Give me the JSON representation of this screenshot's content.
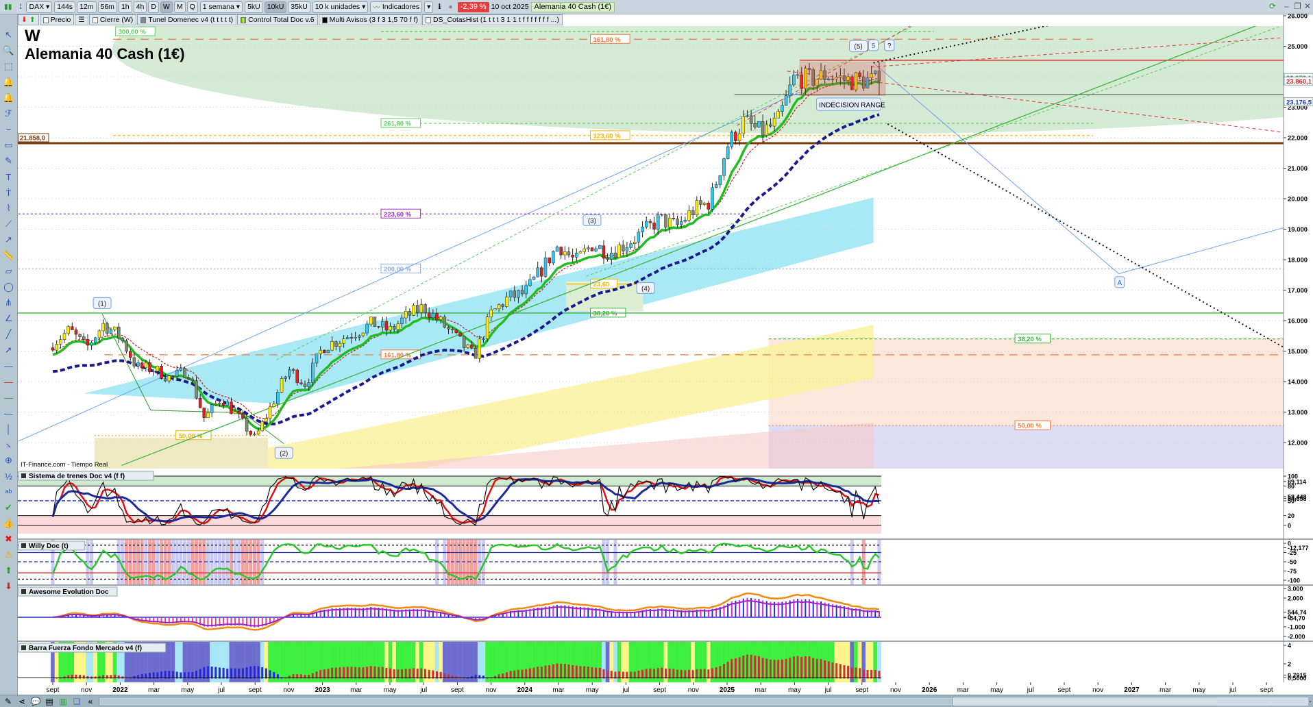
{
  "toolbar": {
    "symbol": "DAX",
    "timeframes": [
      "144s",
      "12m",
      "56m",
      "1h",
      "4h",
      "D",
      "W",
      "M",
      "Q"
    ],
    "active_timeframe": "W",
    "period": "1 semana",
    "units": [
      "5kU",
      "10kU",
      "35kU"
    ],
    "active_unit": "10kU",
    "units_select": "10 k unidades",
    "indicators": "Indicadores",
    "change": "-2,39 %",
    "date": "10 oct 2025",
    "instrument": "Alemania 40 Cash (1€)"
  },
  "legend": {
    "items": [
      "Precio",
      "Cierre (W)",
      "Tunel Domenec v4 (t t t t t)",
      "Control Total Doc v.6",
      "Multi Avisos (3 f 3 1,5 70 f f)",
      "DS_CotasHist (1 t t t 3 1 1 t f f f f f f f ...)"
    ]
  },
  "sidebar_icons": [
    "pointer-icon",
    "zoom-icon",
    "zoom-box-icon",
    "alarm-bell-icon",
    "bell-icon",
    "fibonacci-icon",
    "horizontal-line-icon",
    "rectangle-icon",
    "pencil-icon",
    "text-icon",
    "text-t-icon",
    "brush-icon",
    "trendline-icon",
    "ray-icon",
    "ruler-icon",
    "channel-icon",
    "ellipse-icon",
    "pitchfork-icon",
    "angle-icon",
    "line-icon",
    "arrow-line-icon",
    "segment-icon",
    "red-line-icon",
    "green-line-icon",
    "blue-line-icon",
    "vertical-line-icon",
    "angle-measure-icon",
    "target-icon",
    "elliott-numbers-icon",
    "elliott-letters-icon",
    "check-icon",
    "thumbs-up-icon",
    "cross-icon",
    "warning-icon",
    "arrow-up-icon",
    "arrow-down-icon"
  ],
  "chart": {
    "timeframe_letter": "W",
    "title": "Alemania 40 Cash (1€)",
    "source": "IT-Finance.com - Tiempo Real",
    "left_price_label": "21.858,0",
    "indecision_label": "INDECISION RANGE",
    "wave_labels": [
      "(1)",
      "(2)",
      "(3)",
      "(4)",
      "(5)",
      "5",
      "?",
      "A"
    ],
    "price_tags": [
      {
        "label": "23.972,1",
        "value": 23972,
        "color": "#2e7d32"
      },
      {
        "label": "23.860,1",
        "value": 23860,
        "color": "#c62828"
      },
      {
        "label": "23.176,5",
        "value": 23176,
        "color": "#1a3fc0"
      }
    ],
    "fib_levels": [
      {
        "label": "300,00 %",
        "value": 25480,
        "color": "#5ccf5c"
      },
      {
        "label": "161,80 %",
        "value": 25230,
        "color": "#f07b3f"
      },
      {
        "label": "261,80 %",
        "value": 22470,
        "color": "#5ccf5c"
      },
      {
        "label": "123,60 %",
        "value": 22070,
        "color": "#f4b400"
      },
      {
        "label": "223,60 %",
        "value": 19500,
        "color": "#9a2fc0"
      },
      {
        "label": "200,00 %",
        "value": 17700,
        "color": "#8fb0e0"
      },
      {
        "label": "23,60",
        "value": 17200,
        "color": "#f4b400"
      },
      {
        "label": "38,20 %",
        "value": 16250,
        "color": "#3cb43c"
      },
      {
        "label": "38,20 %",
        "value": 15400,
        "color": "#3cb43c"
      },
      {
        "label": "161,80 %",
        "value": 14880,
        "color": "#f07b3f"
      },
      {
        "label": "50,00 %",
        "value": 12560,
        "color": "#f07b3f"
      },
      {
        "label": "50,00 %",
        "value": 12230,
        "color": "#f4b400"
      }
    ],
    "price_axis": [
      {
        "label": "26.000",
        "value": 26000
      },
      {
        "label": "25.000",
        "value": 25000
      },
      {
        "label": "24.000",
        "value": 24000
      },
      {
        "label": "23.000",
        "value": 23000
      },
      {
        "label": "22.000",
        "value": 22000
      },
      {
        "label": "21.000",
        "value": 21000
      },
      {
        "label": "20.000",
        "value": 20000
      },
      {
        "label": "19.000",
        "value": 19000
      },
      {
        "label": "18.000",
        "value": 18000
      },
      {
        "label": "17.000",
        "value": 17000
      },
      {
        "label": "16.000",
        "value": 16000
      },
      {
        "label": "15.000",
        "value": 15000
      },
      {
        "label": "14.000",
        "value": 14000
      },
      {
        "label": "13.000",
        "value": 13000
      },
      {
        "label": "12.000",
        "value": 12000
      }
    ]
  },
  "x_axis": [
    "sept",
    "nov",
    "2022",
    "mar",
    "may",
    "jul",
    "sept",
    "nov",
    "2023",
    "mar",
    "may",
    "jul",
    "sept",
    "nov",
    "2024",
    "mar",
    "may",
    "jul",
    "sept",
    "nov",
    "2025",
    "mar",
    "may",
    "jul",
    "sept",
    "nov",
    "2026",
    "mar",
    "may",
    "jul",
    "sept",
    "nov",
    "2027",
    "mar",
    "may",
    "jul",
    "sept"
  ],
  "panels": [
    {
      "title": "Sistema de trenes Doc v4 (f f)",
      "axis": [
        {
          "label": "100",
          "value": 100
        },
        {
          "label": "89,114",
          "value": 89.1
        },
        {
          "label": "80",
          "value": 80
        },
        {
          "label": "58,448",
          "value": 58.4
        },
        {
          "label": "54,658",
          "value": 54.7
        },
        {
          "label": "50",
          "value": 50
        },
        {
          "label": "20",
          "value": 20
        },
        {
          "label": "0",
          "value": 0
        }
      ]
    },
    {
      "title": "Willy Doc (t)",
      "axis": [
        {
          "label": "0",
          "value": 0
        },
        {
          "label": "-12,177",
          "value": -12
        },
        {
          "label": "-25",
          "value": -25
        },
        {
          "label": "-50",
          "value": -50
        },
        {
          "label": "-75",
          "value": -75
        },
        {
          "label": "-100",
          "value": -100
        }
      ]
    },
    {
      "title": "Awesome Evolution Doc",
      "axis": [
        {
          "label": "3.000",
          "value": 3000
        },
        {
          "label": "2.000",
          "value": 2000
        },
        {
          "label": "544,74",
          "value": 544
        },
        {
          "label": "-54,70",
          "value": -54
        },
        {
          "label": "0",
          "value": 0
        },
        {
          "label": "-1.000",
          "value": -1000
        },
        {
          "label": "-2.000",
          "value": -2000
        }
      ]
    },
    {
      "title": "Barra Fuerza Fondo Mercado v4 (f)",
      "axis": [
        {
          "label": "4",
          "value": 4
        },
        {
          "label": "2",
          "value": 2
        },
        {
          "label": "0,7915",
          "value": 0.79
        },
        {
          "label": "0,5000",
          "value": 0.5
        }
      ]
    }
  ],
  "chart_data": {
    "type": "candlestick",
    "title": "Alemania 40 Cash (1€) — W",
    "xlabel": "",
    "ylabel": "",
    "start": "2021-09",
    "monthly_closes": [
      15260,
      15690,
      15100,
      15885,
      15470,
      14460,
      14415,
      14100,
      14390,
      12780,
      13480,
      12830,
      12115,
      13250,
      14400,
      13920,
      15130,
      15365,
      15630,
      15920,
      15660,
      16150,
      16450,
      15950,
      15390,
      14810,
      16215,
      16750,
      16900,
      17680,
      18490,
      17930,
      18500,
      18235,
      18510,
      18900,
      19325,
      19080,
      19625,
      19910,
      21730,
      22550,
      22160,
      22500,
      23990,
      23910,
      24065,
      23900,
      23880,
      23860
    ],
    "ylim": [
      11500,
      26000
    ]
  },
  "colors": {
    "up": "#35c6ef",
    "up_alt": "#ffee00",
    "down": "#e02020",
    "down_alt": "#7e8b6e",
    "ema_fast": "#22bb22",
    "ema_slow": "#1a1a8c"
  }
}
